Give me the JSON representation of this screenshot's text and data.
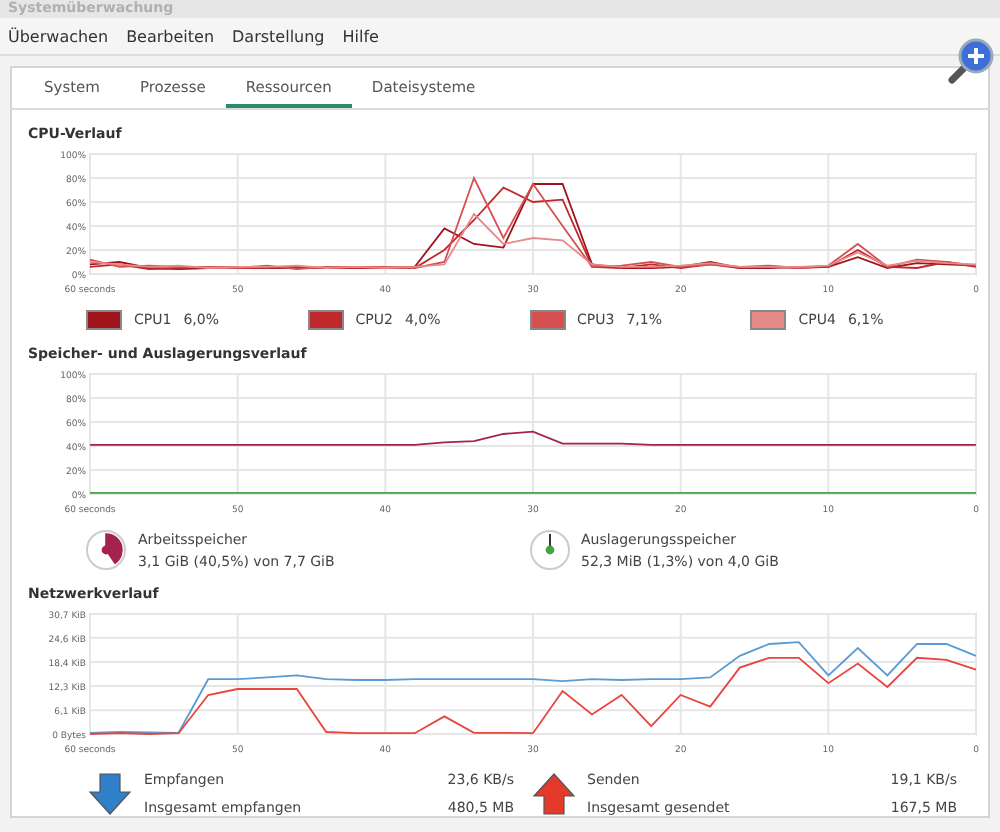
{
  "window": {
    "title": "Systemüberwachung"
  },
  "menu": [
    "Überwachen",
    "Bearbeiten",
    "Darstellung",
    "Hilfe"
  ],
  "tabs": [
    {
      "label": "System",
      "selected": false
    },
    {
      "label": "Prozesse",
      "selected": false
    },
    {
      "label": "Ressourcen",
      "selected": true
    },
    {
      "label": "Dateisysteme",
      "selected": false
    }
  ],
  "cpu": {
    "title": "CPU-Verlauf",
    "chart_data": {
      "type": "line",
      "grid": true,
      "x": [
        60,
        58,
        56,
        54,
        52,
        50,
        48,
        46,
        44,
        42,
        40,
        38,
        36,
        34,
        32,
        30,
        28,
        26,
        24,
        22,
        20,
        18,
        16,
        14,
        12,
        10,
        8,
        6,
        4,
        2,
        0
      ],
      "xlim": [
        60,
        0
      ],
      "ylim": [
        0,
        100
      ],
      "xticks": [
        {
          "value": 60,
          "label": "60 seconds"
        },
        50,
        40,
        30,
        20,
        10,
        0
      ],
      "yticks": [
        {
          "value": 0,
          "label": "0%"
        },
        {
          "value": 20,
          "label": "20%"
        },
        {
          "value": 40,
          "label": "40%"
        },
        {
          "value": 60,
          "label": "60%"
        },
        {
          "value": 80,
          "label": "80%"
        },
        {
          "value": 100,
          "label": "100%"
        }
      ],
      "series": [
        {
          "name": "CPU1",
          "color": "#a0141c",
          "values": [
            8,
            10,
            5,
            4,
            5,
            6,
            5,
            5,
            5,
            5,
            5,
            6,
            38,
            25,
            22,
            75,
            75,
            8,
            5,
            5,
            6,
            10,
            5,
            5,
            6,
            6,
            14,
            5,
            9,
            8,
            7
          ]
        },
        {
          "name": "CPU2",
          "color": "#c0282e",
          "values": [
            6,
            8,
            4,
            5,
            6,
            5,
            5,
            6,
            5,
            5,
            5,
            5,
            20,
            45,
            72,
            60,
            62,
            6,
            5,
            8,
            5,
            8,
            5,
            6,
            5,
            6,
            20,
            6,
            5,
            10,
            6
          ]
        },
        {
          "name": "CPU3",
          "color": "#d55050",
          "values": [
            12,
            6,
            7,
            6,
            6,
            5,
            7,
            4,
            6,
            6,
            6,
            5,
            10,
            80,
            30,
            75,
            40,
            6,
            7,
            10,
            6,
            8,
            6,
            7,
            5,
            7,
            25,
            6,
            12,
            10,
            7
          ]
        },
        {
          "name": "CPU4",
          "color": "#e88a8a",
          "values": [
            10,
            8,
            6,
            7,
            5,
            6,
            6,
            7,
            5,
            6,
            5,
            6,
            8,
            50,
            25,
            30,
            28,
            8,
            6,
            6,
            7,
            9,
            6,
            6,
            6,
            7,
            18,
            7,
            11,
            9,
            8
          ]
        }
      ]
    },
    "legend": [
      {
        "reading": "6,0%"
      },
      {
        "reading": "4,0%"
      },
      {
        "reading": "7,1%"
      },
      {
        "reading": "6,1%"
      }
    ]
  },
  "memory": {
    "title": "Speicher- und Auslagerungsverlauf",
    "chart_data": {
      "type": "line",
      "grid": true,
      "x": [
        60,
        58,
        56,
        54,
        52,
        50,
        48,
        46,
        44,
        42,
        40,
        38,
        36,
        34,
        32,
        30,
        28,
        26,
        24,
        22,
        20,
        18,
        16,
        14,
        12,
        10,
        8,
        6,
        4,
        2,
        0
      ],
      "xlim": [
        60,
        0
      ],
      "ylim": [
        0,
        100
      ],
      "xticks": [
        {
          "value": 60,
          "label": "60 seconds"
        },
        50,
        40,
        30,
        20,
        10,
        0
      ],
      "yticks": [
        {
          "value": 0,
          "label": "0%"
        },
        {
          "value": 20,
          "label": "20%"
        },
        {
          "value": 40,
          "label": "40%"
        },
        {
          "value": 60,
          "label": "60%"
        },
        {
          "value": 80,
          "label": "80%"
        },
        {
          "value": 100,
          "label": "100%"
        }
      ],
      "series": [
        {
          "name": "Arbeitsspeicher",
          "color": "#a3224f",
          "values": [
            41,
            41,
            41,
            41,
            41,
            41,
            41,
            41,
            41,
            41,
            41,
            41,
            43,
            44,
            50,
            52,
            42,
            42,
            42,
            41,
            41,
            41,
            41,
            41,
            41,
            41,
            41,
            41,
            41,
            41,
            41
          ]
        },
        {
          "name": "Auslagerungsspeicher",
          "color": "#4aa047",
          "values": [
            1,
            1,
            1,
            1,
            1,
            1,
            1,
            1,
            1,
            1,
            1,
            1,
            1,
            1,
            1,
            1,
            1,
            1,
            1,
            1,
            1,
            1,
            1,
            1,
            1,
            1,
            1,
            1,
            1,
            1,
            1
          ]
        }
      ]
    },
    "legend": [
      {
        "detail": "3,1 GiB (40,5%) von 7,7 GiB",
        "level": 0.405
      },
      {
        "detail": "52,3 MiB (1,3%) von 4,0 GiB"
      }
    ]
  },
  "network": {
    "title": "Netzwerkverlauf",
    "chart_data": {
      "type": "line",
      "grid": true,
      "x": [
        60,
        58,
        56,
        54,
        52,
        50,
        48,
        46,
        44,
        42,
        40,
        38,
        36,
        34,
        32,
        30,
        28,
        26,
        24,
        22,
        20,
        18,
        16,
        14,
        12,
        10,
        8,
        6,
        4,
        2,
        0
      ],
      "xlim": [
        60,
        0
      ],
      "ylim": [
        0,
        30.7
      ],
      "xticks": [
        {
          "value": 60,
          "label": "60 seconds"
        },
        50,
        40,
        30,
        20,
        10,
        0
      ],
      "yticks": [
        {
          "value": 0,
          "label": "0 Bytes"
        },
        {
          "value": 6.1,
          "label": "6,1 KiB"
        },
        {
          "value": 12.3,
          "label": "12,3 KiB"
        },
        {
          "value": 18.4,
          "label": "18,4 KiB"
        },
        {
          "value": 24.6,
          "label": "24,6 KiB"
        },
        {
          "value": 30.7,
          "label": "30,7 KiB"
        }
      ],
      "series": [
        {
          "name": "Empfangen",
          "color": "#5b9bd5",
          "values": [
            0.3,
            0.5,
            0.4,
            0.3,
            14,
            14,
            14.5,
            15,
            14,
            13.8,
            13.8,
            14,
            14,
            14,
            14,
            14,
            13.5,
            14,
            13.8,
            14,
            14,
            14.5,
            20,
            23,
            23.5,
            15,
            22,
            15,
            23,
            23,
            20
          ]
        },
        {
          "name": "Senden",
          "color": "#e8453c",
          "values": [
            0,
            0.2,
            0,
            0.2,
            10,
            11.5,
            11.5,
            11.5,
            0.5,
            0.2,
            0.2,
            0.2,
            4.5,
            0.3,
            0.3,
            0.2,
            11,
            5,
            10,
            2,
            10,
            7,
            17,
            19.5,
            19.5,
            13,
            18,
            12,
            19.5,
            19,
            16.5
          ]
        }
      ]
    },
    "legend": [
      {
        "kind": "download",
        "rate": "23,6 KB/s",
        "total_label": "Insgesamt empfangen",
        "total": "480,5 MB"
      },
      {
        "kind": "upload",
        "rate": "19,1 KB/s",
        "total_label": "Insgesamt gesendet",
        "total": "167,5 MB"
      }
    ]
  }
}
